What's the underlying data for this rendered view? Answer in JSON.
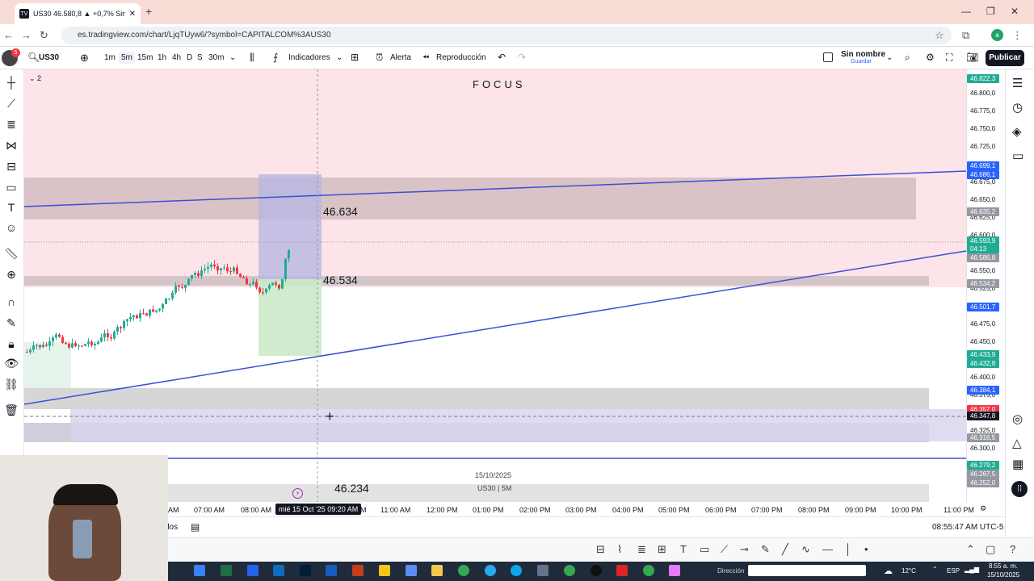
{
  "browser": {
    "tab_title": "US30 46.580,8 ▲ +0,7% Sin nom",
    "url": "es.tradingview.com/chart/LjqTUyw6/?symbol=CAPITALCOM%3AUS30",
    "profile_initial": "a",
    "badge_count": "5"
  },
  "toolbar": {
    "symbol": "US30",
    "intervals": [
      "1m",
      "5m",
      "15m",
      "1h",
      "4h",
      "D",
      "S",
      "30m"
    ],
    "active_interval": "5m",
    "indicators": "Indicadores",
    "alert": "Alerta",
    "replay": "Reproducción",
    "layout_name": "Sin nombre",
    "save": "Guardar",
    "publish": "Publicar"
  },
  "chart": {
    "legend_collapse": "2",
    "focus_title": "FOCUS",
    "label_top": "46.634",
    "label_mid": "46.534",
    "label_bottom": "46.234",
    "watermark_date": "15/10/2025",
    "watermark_symbol": "US30 | 5M"
  },
  "price_axis": {
    "ticks": [
      "46.800,0",
      "46.775,0",
      "46.750,0",
      "46.725,0",
      "46.700,0",
      "46.675,0",
      "46.650,0",
      "46.625,0",
      "46.600,0",
      "46.575,0",
      "46.550,0",
      "46.525,0",
      "46.475,0",
      "46.450,0",
      "46.400,0",
      "46.375,0",
      "46.325,0",
      "46.300,0"
    ],
    "tags": [
      {
        "text": "46.822,3",
        "color": "#22ab94"
      },
      {
        "text": "46.699,1",
        "color": "#2962ff"
      },
      {
        "text": "46.686,1",
        "color": "#2962ff"
      },
      {
        "text": "46.635,2",
        "color": "#9598a1"
      },
      {
        "text": "46.593,9",
        "color": "#22ab94"
      },
      {
        "text": "04:13",
        "color": "#22ab94"
      },
      {
        "text": "46.586,8",
        "color": "#9598a1"
      },
      {
        "text": "46.534,2",
        "color": "#9598a1"
      },
      {
        "text": "46.501,7",
        "color": "#2962ff"
      },
      {
        "text": "46.433,9",
        "color": "#22ab94"
      },
      {
        "text": "46.432,8",
        "color": "#22ab94"
      },
      {
        "text": "46.384,1",
        "color": "#2962ff"
      },
      {
        "text": "46.357,0",
        "color": "#f23645"
      },
      {
        "text": "46.347,8",
        "color": "#131722"
      },
      {
        "text": "46.316,5",
        "color": "#9598a1"
      },
      {
        "text": "46.279,2",
        "color": "#22ab94"
      },
      {
        "text": "46.267,5",
        "color": "#9598a1"
      },
      {
        "text": "46.252,0",
        "color": "#9598a1"
      }
    ]
  },
  "time_axis": {
    "labels": [
      "AM",
      "07:00 AM",
      "08:00 AM",
      "AM",
      "11:00 AM",
      "12:00 PM",
      "01:00 PM",
      "02:00 PM",
      "03:00 PM",
      "04:00 PM",
      "05:00 PM",
      "06:00 PM",
      "07:00 PM",
      "08:00 PM",
      "09:00 PM",
      "10:00 PM",
      "11:00 PM"
    ],
    "crosshair_label": "mié 15 Oct '25   09:20 AM"
  },
  "bottom": {
    "left_text": "dos",
    "clock": "08:55:47 AM UTC-5"
  },
  "taskbar": {
    "search_label": "Dirección",
    "weather": "12°C",
    "lang": "ESP",
    "time": "8:55 a. m.",
    "date": "15/10/2025"
  }
}
